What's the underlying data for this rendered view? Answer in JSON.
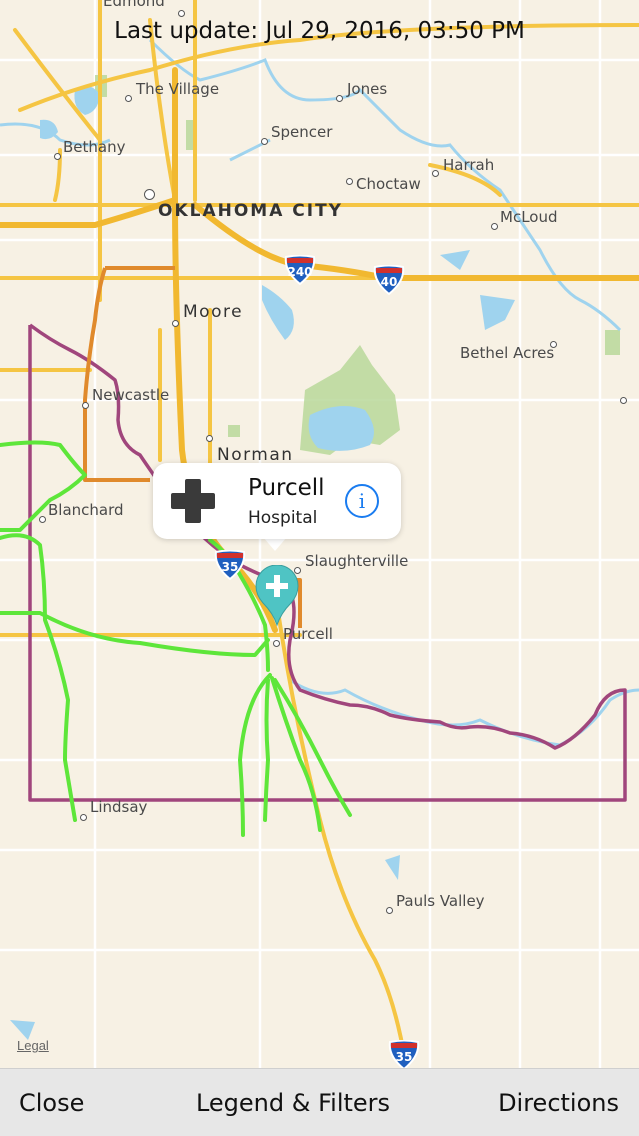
{
  "status": {
    "last_update": "Last update: Jul 29, 2016, 03:50 PM"
  },
  "map": {
    "labels": {
      "edmond": "Edmond",
      "the_village": "The Village",
      "jones": "Jones",
      "spencer": "Spencer",
      "bethany": "Bethany",
      "harrah": "Harrah",
      "choctaw": "Choctaw",
      "oklahoma_city": "OKLAHOMA CITY",
      "mcloud": "McLoud",
      "moore": "Moore",
      "bethel_acres": "Bethel Acres",
      "newcastle": "Newcastle",
      "norman": "Norman",
      "blanchard": "Blanchard",
      "slaughterville": "Slaughterville",
      "purcell": "Purcell",
      "lindsay": "Lindsay",
      "pauls_valley": "Pauls Valley"
    },
    "shields": {
      "i240": "240",
      "i40": "40",
      "i35_north": "35",
      "i35_south": "35"
    },
    "legal": "Legal",
    "colors": {
      "background": "#f7f1e4",
      "highway": "#f5c543",
      "water": "#9fd3ee",
      "park": "#b9d89a",
      "green_route": "#5ee63a",
      "purple_boundary": "#a0467c",
      "orange_route": "#e08a2c",
      "pin": "#4fc4c4"
    }
  },
  "callout": {
    "title": "Purcell",
    "subtitle": "Hospital",
    "icon": "plus-cross-icon",
    "info_icon": "info-icon",
    "info_glyph": "i"
  },
  "toolbar": {
    "close_label": "Close",
    "legend_label": "Legend & Filters",
    "directions_label": "Directions"
  }
}
